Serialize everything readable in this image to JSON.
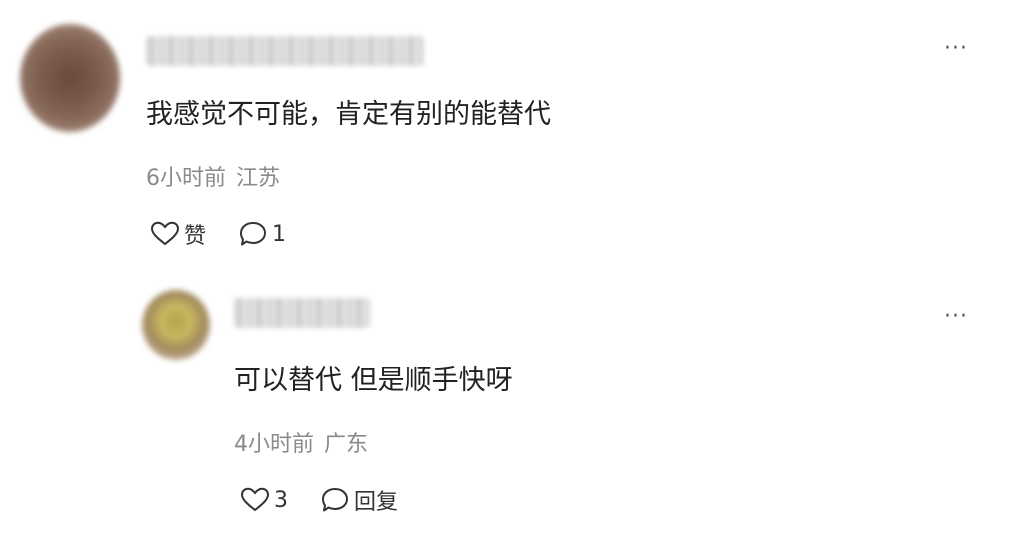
{
  "comments": [
    {
      "content": "我感觉不可能，肯定有别的能替代",
      "time": "6小时前",
      "location": "江苏",
      "like_label": "赞",
      "reply_count": "1",
      "more_label": "···"
    },
    {
      "content": "可以替代 但是顺手快呀",
      "time": "4小时前",
      "location": "广东",
      "like_count": "3",
      "reply_label": "回复",
      "more_label": "···"
    }
  ],
  "icons": {
    "like": "heart-outline-icon",
    "reply": "speech-bubble-outline-icon",
    "more": "ellipsis-icon"
  },
  "colors": {
    "text_primary": "#222222",
    "text_meta": "#8a8a8a",
    "background": "#ffffff"
  }
}
